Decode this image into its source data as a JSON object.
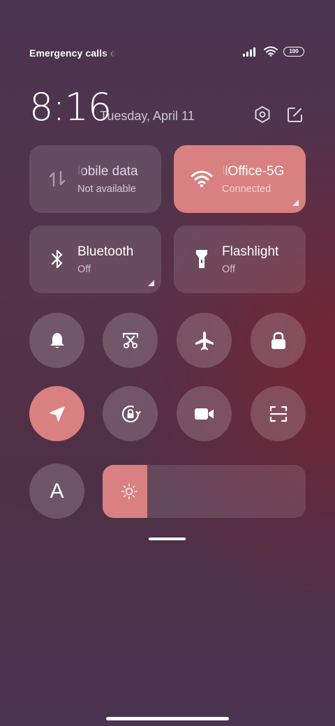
{
  "status_bar": {
    "carrier_text": "Emergency calls o",
    "battery": "100"
  },
  "header": {
    "time": "8:16",
    "date": "Tuesday, April 11"
  },
  "tiles": {
    "mobile_data": {
      "title": "lobile data",
      "subtitle": "Not available"
    },
    "wifi": {
      "title": "llOffice-5G",
      "subtitle": "Connected"
    },
    "bluetooth": {
      "title": "Bluetooth",
      "subtitle": "Off"
    },
    "flashlight": {
      "title": "Flashlight",
      "subtitle": "Off"
    }
  },
  "text_size_button": {
    "label": "A"
  },
  "brightness": {
    "level": 0.22
  },
  "colors": {
    "accent": "#d98080"
  }
}
